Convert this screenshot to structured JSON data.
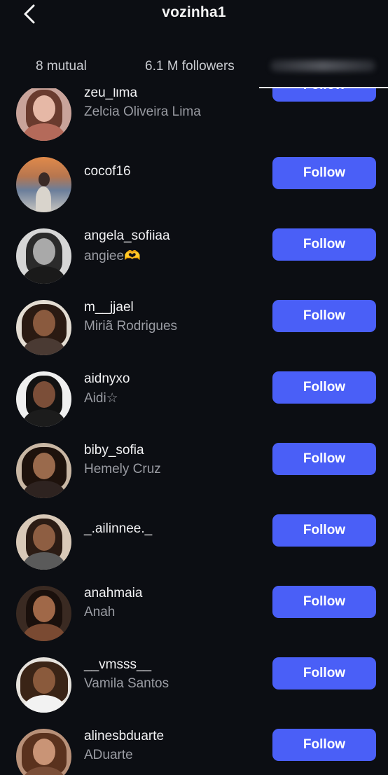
{
  "header": {
    "title": "vozinha1",
    "back_icon": "chevron-left-icon"
  },
  "tabs": [
    {
      "label": "8 mutual"
    },
    {
      "label": "6.1 M followers"
    }
  ],
  "follow_label": "Follow",
  "colors": {
    "background": "#0c0e13",
    "follow_button": "#4a5ff7",
    "secondary_text": "#9a9ca3"
  },
  "users": [
    {
      "username": "zeu_lima",
      "full_name": "Zelcia Oliveira Lima",
      "avatar": "avatar-photo"
    },
    {
      "username": "cocof16",
      "full_name": "",
      "avatar": "avatar-photo"
    },
    {
      "username": "angela_sofiiaa",
      "full_name": "angiee🫶",
      "avatar": "avatar-photo"
    },
    {
      "username": "m__jjael",
      "full_name": "Miriã Rodrigues",
      "avatar": "avatar-photo"
    },
    {
      "username": "aidnyxo",
      "full_name": "Aidi☆",
      "avatar": "avatar-photo"
    },
    {
      "username": "biby_sofia",
      "full_name": "Hemely Cruz",
      "avatar": "avatar-photo"
    },
    {
      "username": "_.ailinnee._",
      "full_name": "",
      "avatar": "avatar-photo"
    },
    {
      "username": "anahmaia",
      "full_name": "Anah",
      "avatar": "avatar-photo"
    },
    {
      "username": "__vmsss__",
      "full_name": "Vamila Santos",
      "avatar": "avatar-photo"
    },
    {
      "username": "alinesbduarte",
      "full_name": "ADuarte",
      "avatar": "avatar-photo"
    }
  ]
}
